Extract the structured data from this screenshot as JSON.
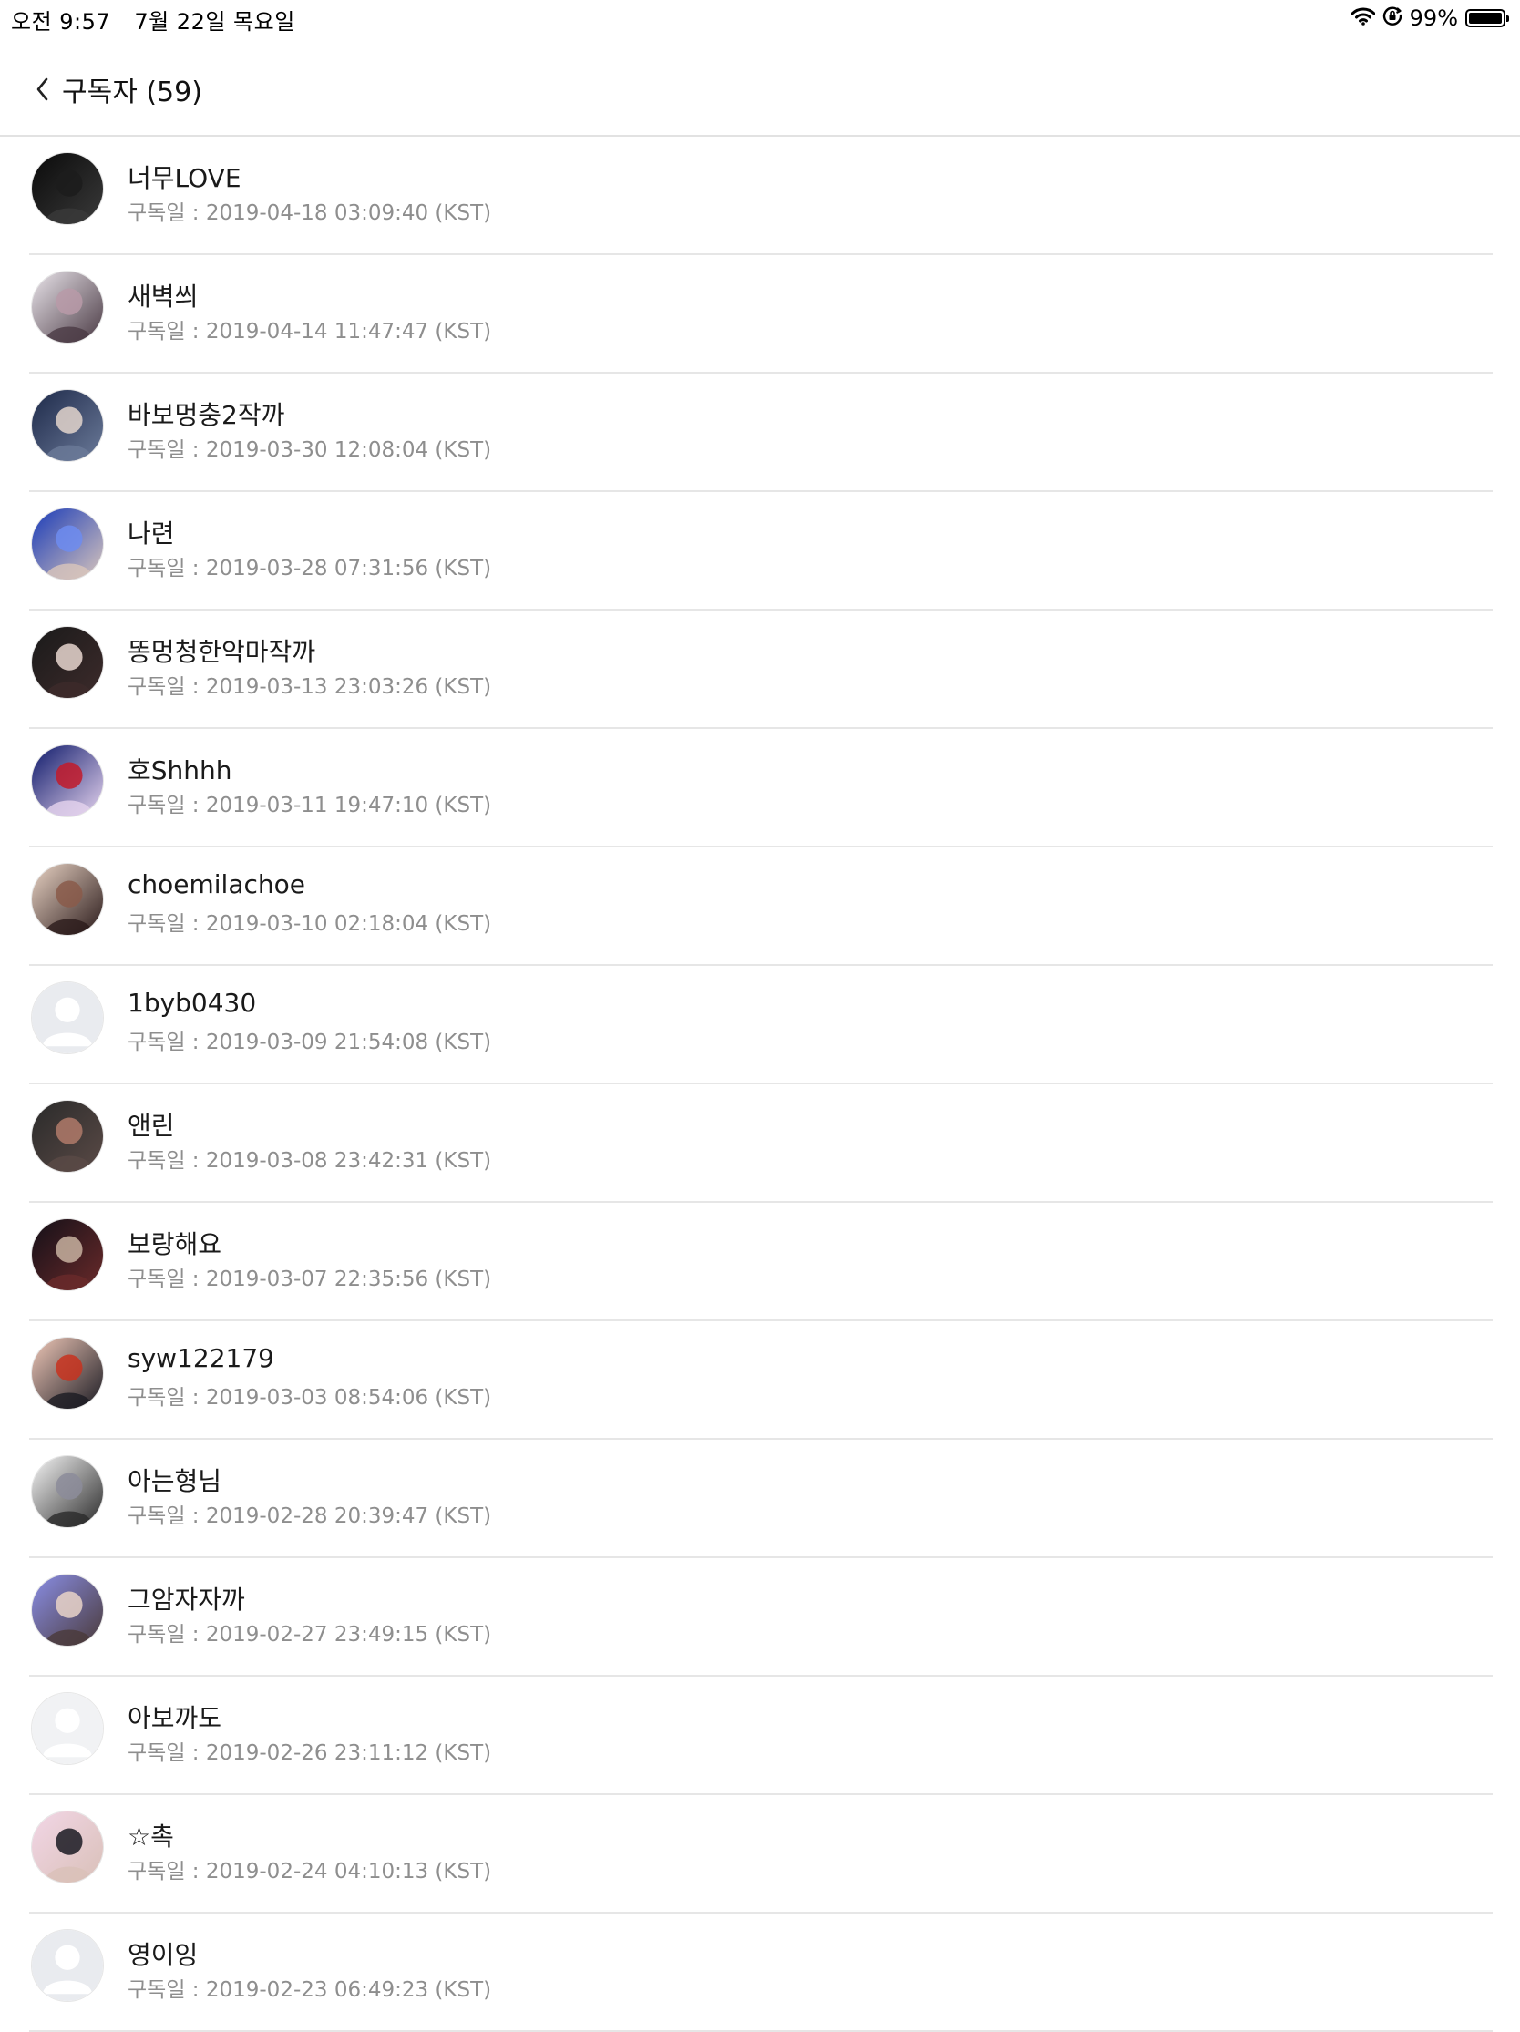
{
  "status_bar": {
    "time": "오전 9:57",
    "date": "7월 22일 목요일",
    "battery": "99%",
    "wifi_icon": "wifi-icon",
    "lock_icon": "orientation-lock-icon",
    "battery_level": 0.99
  },
  "nav": {
    "back_icon": "chevron-left-icon",
    "title": "구독자 (59)"
  },
  "subscribers": [
    {
      "name": "너무LOVE",
      "date": "구독일 : 2019-04-18 03:09:40 (KST)",
      "avatar": "photo",
      "colors": [
        "#0a0a0a",
        "#1c1c1c",
        "#3a3a3a"
      ]
    },
    {
      "name": "새벽씌",
      "date": "구독일 : 2019-04-14 11:47:47 (KST)",
      "avatar": "photo",
      "colors": [
        "#e9e4ea",
        "#b99aa8",
        "#4a3a44"
      ]
    },
    {
      "name": "바보멍충2작까",
      "date": "구독일 : 2019-03-30 12:08:04 (KST)",
      "avatar": "photo",
      "colors": [
        "#1e2a4a",
        "#e3d5cc",
        "#6b7a99"
      ]
    },
    {
      "name": "나련",
      "date": "구독일 : 2019-03-28 07:31:56 (KST)",
      "avatar": "photo",
      "colors": [
        "#1a3bb8",
        "#6d8cf0",
        "#d9c6bc"
      ]
    },
    {
      "name": "똥멍청한악마작까",
      "date": "구독일 : 2019-03-13 23:03:26 (KST)",
      "avatar": "photo",
      "colors": [
        "#1a1a1a",
        "#e8d6cf",
        "#3d2b2b"
      ]
    },
    {
      "name": "호Shhhh",
      "date": "구독일 : 2019-03-11 19:47:10 (KST)",
      "avatar": "photo",
      "colors": [
        "#0f1a6b",
        "#c21a2a",
        "#e5d3ee"
      ]
    },
    {
      "name": "choemilachoe",
      "date": "구독일 : 2019-03-10 02:18:04 (KST)",
      "avatar": "photo",
      "colors": [
        "#e9d3c4",
        "#8a5a4a",
        "#2a1a1a"
      ]
    },
    {
      "name": "1byb0430",
      "date": "구독일 : 2019-03-09 21:54:08 (KST)",
      "avatar": "default",
      "colors": [
        "#e9ebef",
        "#ffffff",
        "#d6d9de"
      ]
    },
    {
      "name": "앤린",
      "date": "구독일 : 2019-03-08 23:42:31 (KST)",
      "avatar": "photo",
      "colors": [
        "#2a2a2a",
        "#b07a6a",
        "#5a4a46"
      ]
    },
    {
      "name": "보랑해요",
      "date": "구독일 : 2019-03-07 22:35:56 (KST)",
      "avatar": "photo",
      "colors": [
        "#141018",
        "#c8b2a0",
        "#6a2a2a"
      ]
    },
    {
      "name": "syw122179",
      "date": "구독일 : 2019-03-03 08:54:06 (KST)",
      "avatar": "photo",
      "colors": [
        "#f0c8b8",
        "#c8321e",
        "#1a1a22"
      ]
    },
    {
      "name": "아는형님",
      "date": "구독일 : 2019-02-28 20:39:47 (KST)",
      "avatar": "photo",
      "colors": [
        "#f6f6f6",
        "#8c8c9a",
        "#2a2a2a"
      ]
    },
    {
      "name": "그암자자까",
      "date": "구독일 : 2019-02-27 23:49:15 (KST)",
      "avatar": "photo",
      "colors": [
        "#8a8ee6",
        "#e9d3c8",
        "#4a3a3a"
      ]
    },
    {
      "name": "아보까도",
      "date": "구독일 : 2019-02-26 23:11:12 (KST)",
      "avatar": "default",
      "colors": [
        "#f1f2f4",
        "#ffffff",
        "#e3e5e8"
      ]
    },
    {
      "name": "☆촉",
      "date": "구독일 : 2019-02-24 04:10:13 (KST)",
      "avatar": "photo",
      "colors": [
        "#f2d6e6",
        "#1a1a22",
        "#d9c0b8"
      ]
    },
    {
      "name": "영이잉",
      "date": "구독일 : 2019-02-23 06:49:23 (KST)",
      "avatar": "default",
      "colors": [
        "#e9ebef",
        "#ffffff",
        "#d6d9de"
      ]
    }
  ]
}
